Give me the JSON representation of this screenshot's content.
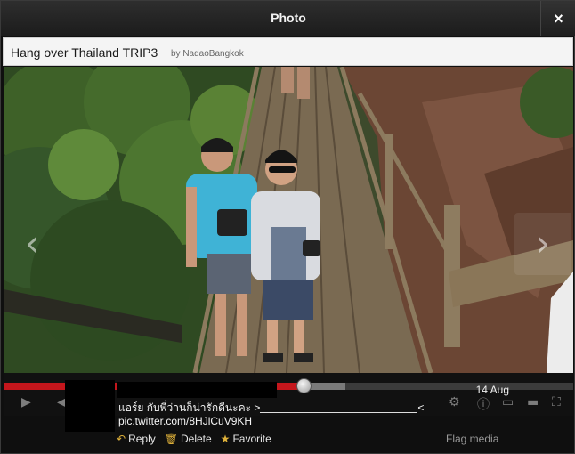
{
  "modal": {
    "title": "Photo",
    "close_glyph": "×"
  },
  "header": {
    "video_title": "Hang over Thailand TRIP3",
    "byline": "by NadaoBangkok"
  },
  "nav": {
    "prev_glyph": "‹",
    "next_glyph": "›"
  },
  "player": {
    "progress_fraction": 0.515,
    "buffered_fraction": 0.6
  },
  "tweet": {
    "timestamp": "14 Aug",
    "text_line1": "แอร์ย กับพี่ว่านก็น่ารักดีนะคะ >",
    "text_line1_end": "<",
    "text_line2": "pic.twitter.com/8HJlCuV9KH"
  },
  "actions": {
    "reply": {
      "label": "Reply",
      "icon": "reply-arrow-icon"
    },
    "delete": {
      "label": "Delete",
      "icon": "trash-icon"
    },
    "favorite": {
      "label": "Favorite",
      "icon": "star-icon"
    },
    "flag": "Flag media"
  },
  "colors": {
    "progress": "#c4161c",
    "accent_icon": "#e0b23a",
    "header_bg": "#f4f4f4"
  }
}
